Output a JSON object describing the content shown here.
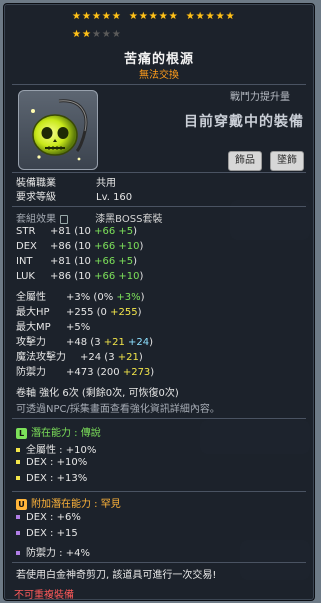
{
  "stars": {
    "filled": 17,
    "total": 20
  },
  "item": {
    "name": "苦痛的根源",
    "trade_status": "無法交換",
    "cp_label": "戰鬥力提升量",
    "cp_text": "目前穿戴中的裝備",
    "tags": [
      "飾品",
      "墜飾"
    ]
  },
  "req": {
    "job_label": "裝備職業",
    "job_value": "共用",
    "level_label": "要求等級",
    "level_value": "Lv. 160"
  },
  "set": {
    "label": "套組效果",
    "value": "漆黑BOSS套裝"
  },
  "stats": [
    {
      "name": "STR",
      "total": "+81",
      "open": " (10 ",
      "bonus": "+66",
      "star": "+5",
      "close": ")"
    },
    {
      "name": "DEX",
      "total": "+86",
      "open": " (10 ",
      "bonus": "+66",
      "star": "+10",
      "close": ")"
    },
    {
      "name": "INT",
      "total": "+81",
      "open": " (10 ",
      "bonus": "+66",
      "star": "+5",
      "close": ")"
    },
    {
      "name": "LUK",
      "total": "+86",
      "open": " (10 ",
      "bonus": "+66",
      "star": "+10",
      "close": ")"
    }
  ],
  "stats2": [
    {
      "name": "全屬性",
      "total": "+3%",
      "open": " (0% ",
      "bonus": "+3%",
      "close": ")"
    },
    {
      "name": "最大HP",
      "total": "+255",
      "open": " (0 ",
      "star": "+255",
      "close": ")"
    },
    {
      "name": "最大MP",
      "total": "+5%",
      "open": "",
      "close": ""
    },
    {
      "name": "攻擊力",
      "total": "+48",
      "open": " (3 ",
      "star": "+21",
      "extra": "+24",
      "close": ")"
    },
    {
      "name": "魔法攻擊力",
      "total": "+24",
      "open": " (3 ",
      "star": "+21",
      "close": ")"
    },
    {
      "name": "防禦力",
      "total": "+473",
      "open": " (200 ",
      "star": "+273",
      "close": ")"
    }
  ],
  "scroll": {
    "line": "卷軸 強化 6次 (剩餘0次, 可恢復0次)",
    "note": "可透過NPC/採集畫面查看強化資訊詳細內容。"
  },
  "potential": {
    "badge": "L",
    "title": "潛在能力 : 傳說",
    "lines": [
      "全屬性 : +10%",
      "DEX : +10%",
      "DEX : +13%"
    ]
  },
  "bonus_potential": {
    "badge": "U",
    "title": "附加潛在能力 : 罕見",
    "lines": [
      "DEX : +6%",
      "DEX : +15",
      "防禦力 : +4%"
    ]
  },
  "footer": {
    "scissors": "若使用白金神奇剪刀, 該道具可進行一次交易!",
    "unshareable": "不可重複裝備"
  },
  "colors": {
    "star": "#ffc21a",
    "green": "#7ce05a",
    "yellow": "#f2e54a",
    "cyan": "#8de0ff",
    "orange": "#ffb43a",
    "red": "#ff5a5a",
    "legendary": "#7ce05a",
    "unique": "#ffb43a"
  }
}
